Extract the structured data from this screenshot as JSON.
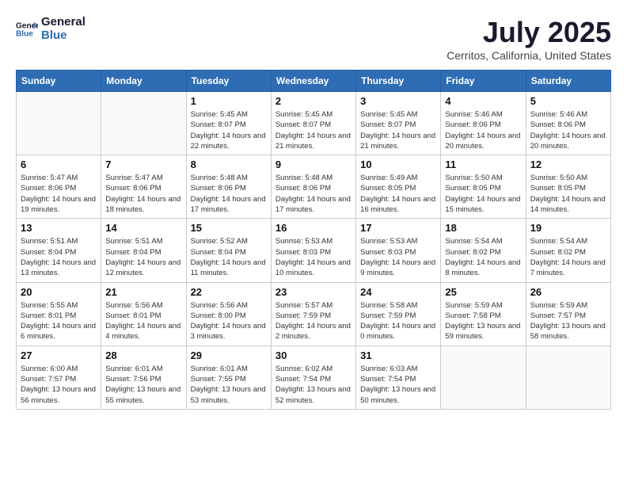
{
  "header": {
    "logo_general": "General",
    "logo_blue": "Blue",
    "month_year": "July 2025",
    "location": "Cerritos, California, United States"
  },
  "days_of_week": [
    "Sunday",
    "Monday",
    "Tuesday",
    "Wednesday",
    "Thursday",
    "Friday",
    "Saturday"
  ],
  "weeks": [
    [
      {
        "day": "",
        "detail": ""
      },
      {
        "day": "",
        "detail": ""
      },
      {
        "day": "1",
        "detail": "Sunrise: 5:45 AM\nSunset: 8:07 PM\nDaylight: 14 hours and 22 minutes."
      },
      {
        "day": "2",
        "detail": "Sunrise: 5:45 AM\nSunset: 8:07 PM\nDaylight: 14 hours and 21 minutes."
      },
      {
        "day": "3",
        "detail": "Sunrise: 5:45 AM\nSunset: 8:07 PM\nDaylight: 14 hours and 21 minutes."
      },
      {
        "day": "4",
        "detail": "Sunrise: 5:46 AM\nSunset: 8:06 PM\nDaylight: 14 hours and 20 minutes."
      },
      {
        "day": "5",
        "detail": "Sunrise: 5:46 AM\nSunset: 8:06 PM\nDaylight: 14 hours and 20 minutes."
      }
    ],
    [
      {
        "day": "6",
        "detail": "Sunrise: 5:47 AM\nSunset: 8:06 PM\nDaylight: 14 hours and 19 minutes."
      },
      {
        "day": "7",
        "detail": "Sunrise: 5:47 AM\nSunset: 8:06 PM\nDaylight: 14 hours and 18 minutes."
      },
      {
        "day": "8",
        "detail": "Sunrise: 5:48 AM\nSunset: 8:06 PM\nDaylight: 14 hours and 17 minutes."
      },
      {
        "day": "9",
        "detail": "Sunrise: 5:48 AM\nSunset: 8:06 PM\nDaylight: 14 hours and 17 minutes."
      },
      {
        "day": "10",
        "detail": "Sunrise: 5:49 AM\nSunset: 8:05 PM\nDaylight: 14 hours and 16 minutes."
      },
      {
        "day": "11",
        "detail": "Sunrise: 5:50 AM\nSunset: 8:05 PM\nDaylight: 14 hours and 15 minutes."
      },
      {
        "day": "12",
        "detail": "Sunrise: 5:50 AM\nSunset: 8:05 PM\nDaylight: 14 hours and 14 minutes."
      }
    ],
    [
      {
        "day": "13",
        "detail": "Sunrise: 5:51 AM\nSunset: 8:04 PM\nDaylight: 14 hours and 13 minutes."
      },
      {
        "day": "14",
        "detail": "Sunrise: 5:51 AM\nSunset: 8:04 PM\nDaylight: 14 hours and 12 minutes."
      },
      {
        "day": "15",
        "detail": "Sunrise: 5:52 AM\nSunset: 8:04 PM\nDaylight: 14 hours and 11 minutes."
      },
      {
        "day": "16",
        "detail": "Sunrise: 5:53 AM\nSunset: 8:03 PM\nDaylight: 14 hours and 10 minutes."
      },
      {
        "day": "17",
        "detail": "Sunrise: 5:53 AM\nSunset: 8:03 PM\nDaylight: 14 hours and 9 minutes."
      },
      {
        "day": "18",
        "detail": "Sunrise: 5:54 AM\nSunset: 8:02 PM\nDaylight: 14 hours and 8 minutes."
      },
      {
        "day": "19",
        "detail": "Sunrise: 5:54 AM\nSunset: 8:02 PM\nDaylight: 14 hours and 7 minutes."
      }
    ],
    [
      {
        "day": "20",
        "detail": "Sunrise: 5:55 AM\nSunset: 8:01 PM\nDaylight: 14 hours and 6 minutes."
      },
      {
        "day": "21",
        "detail": "Sunrise: 5:56 AM\nSunset: 8:01 PM\nDaylight: 14 hours and 4 minutes."
      },
      {
        "day": "22",
        "detail": "Sunrise: 5:56 AM\nSunset: 8:00 PM\nDaylight: 14 hours and 3 minutes."
      },
      {
        "day": "23",
        "detail": "Sunrise: 5:57 AM\nSunset: 7:59 PM\nDaylight: 14 hours and 2 minutes."
      },
      {
        "day": "24",
        "detail": "Sunrise: 5:58 AM\nSunset: 7:59 PM\nDaylight: 14 hours and 0 minutes."
      },
      {
        "day": "25",
        "detail": "Sunrise: 5:59 AM\nSunset: 7:58 PM\nDaylight: 13 hours and 59 minutes."
      },
      {
        "day": "26",
        "detail": "Sunrise: 5:59 AM\nSunset: 7:57 PM\nDaylight: 13 hours and 58 minutes."
      }
    ],
    [
      {
        "day": "27",
        "detail": "Sunrise: 6:00 AM\nSunset: 7:57 PM\nDaylight: 13 hours and 56 minutes."
      },
      {
        "day": "28",
        "detail": "Sunrise: 6:01 AM\nSunset: 7:56 PM\nDaylight: 13 hours and 55 minutes."
      },
      {
        "day": "29",
        "detail": "Sunrise: 6:01 AM\nSunset: 7:55 PM\nDaylight: 13 hours and 53 minutes."
      },
      {
        "day": "30",
        "detail": "Sunrise: 6:02 AM\nSunset: 7:54 PM\nDaylight: 13 hours and 52 minutes."
      },
      {
        "day": "31",
        "detail": "Sunrise: 6:03 AM\nSunset: 7:54 PM\nDaylight: 13 hours and 50 minutes."
      },
      {
        "day": "",
        "detail": ""
      },
      {
        "day": "",
        "detail": ""
      }
    ]
  ]
}
